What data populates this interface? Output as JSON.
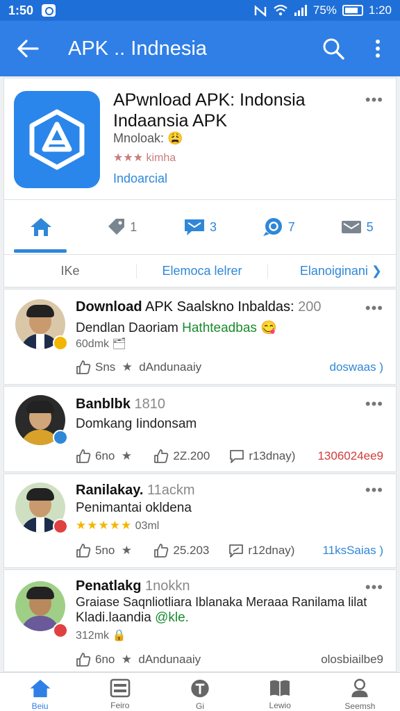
{
  "status": {
    "time": "1:50",
    "battery_text": "75%",
    "right_time": "1:20"
  },
  "appbar": {
    "title": "APK .. Indnesia",
    "back_icon": "arrow-left-icon",
    "search_icon": "search-icon",
    "more_icon": "more-vertical-icon"
  },
  "app": {
    "title_line1": "APwnload APK: Indonsia",
    "title_line2": "Indaansia APK",
    "subtitle": "Mnoloak: 😩",
    "rating_text": "★★★ kimha",
    "link": "Indoarcial"
  },
  "tabs": [
    {
      "icon": "home-icon",
      "count": ""
    },
    {
      "icon": "tag-icon",
      "count": "1"
    },
    {
      "icon": "message-icon",
      "count": "3"
    },
    {
      "icon": "chat-bubble-icon",
      "count": "7"
    },
    {
      "icon": "mail-icon",
      "count": "5"
    }
  ],
  "subtabs": {
    "left": "IKe",
    "middle": "Elemoca lelrer",
    "right": "Elanoiginani ❯"
  },
  "posts": [
    {
      "name_bold": "Download",
      "name_rest": " APK Saalskno Inbaldas:",
      "meta": " 200",
      "line1": "Dendlan Daoriam ",
      "line1_green": "Hathteadbas",
      "line1_emoji": " 😋",
      "small": "60dmk 🗂",
      "like": "Sns",
      "star_text": "dAndunaaiy",
      "right": "doswaas )"
    },
    {
      "name_bold": "Banblbk",
      "meta": " 1810",
      "line1": "Domkang Iindonsam",
      "like": "6no",
      "share_count": "2Z.200",
      "comment_text": "r13dnay)",
      "right": "1306024ee9"
    },
    {
      "name_bold": "Ranilakay.",
      "meta": " 11ackm",
      "line1": "Penimantai okldena",
      "stars": "★★★★★",
      "stars_meta": "03ml",
      "like": "5no",
      "share_count": "25.203",
      "comment_text": "r12dnay)",
      "right": "11ksSaias )"
    },
    {
      "name_bold": "Penatlakg",
      "meta": " 1nokkn",
      "line1": "Graiase Saqnliotliara Iblanaka Meraaa Ranilama lilat",
      "line2": "Kladi.laandia ",
      "line2_green": "@kle.",
      "small": "312mk 🔒",
      "like": "6no",
      "star_text": "dAndunaaiy",
      "right": "olosbiailbe9"
    }
  ],
  "bottomnav": [
    {
      "icon": "home-icon",
      "label": "Beiu"
    },
    {
      "icon": "list-icon",
      "label": "Feiro"
    },
    {
      "icon": "t-circle-icon",
      "label": "Gi"
    },
    {
      "icon": "book-icon",
      "label": "Lewio"
    },
    {
      "icon": "profile-icon",
      "label": "Seemsh"
    }
  ]
}
